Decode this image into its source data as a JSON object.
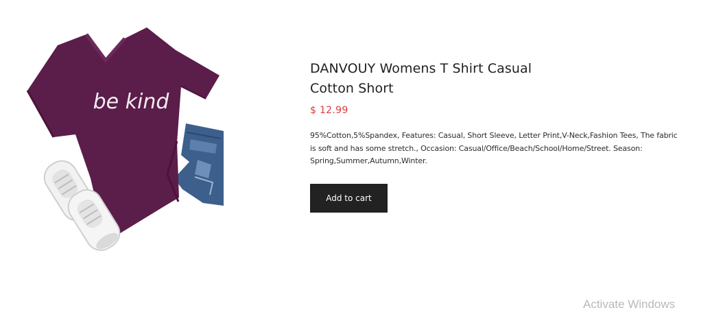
{
  "product": {
    "image_alt": "purple be kind t-shirt",
    "shirt_print": "be kind",
    "title": "DANVOUY Womens T Shirt Casual Cotton Short",
    "price": "$ 12.99",
    "description": "95%Cotton,5%Spandex, Features: Casual, Short Sleeve, Letter Print,V-Neck,Fashion Tees, The fabric is soft and has some stretch., Occasion: Casual/Office/Beach/School/Home/Street. Season: Spring,Summer,Autumn,Winter.",
    "add_to_cart_label": "Add to cart"
  },
  "os_overlay": {
    "watermark": "Activate Windows"
  },
  "colors": {
    "shirt": "#5b1d4a",
    "price": "#e03b3b",
    "button_bg": "#222222",
    "button_text": "#ffffff",
    "denim": "#3d5f8c"
  }
}
